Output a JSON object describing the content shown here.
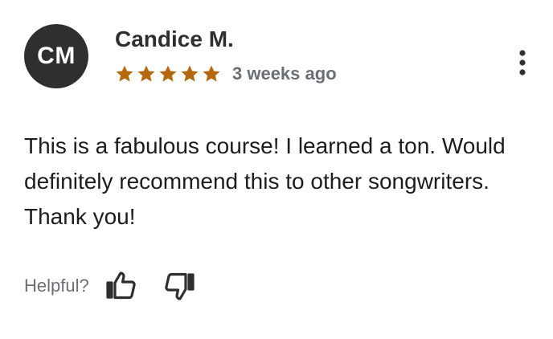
{
  "review": {
    "avatar_initials": "CM",
    "reviewer_name": "Candice M.",
    "rating": 5,
    "rating_max": 5,
    "star_color": "#b4690e",
    "date": "3 weeks ago",
    "more_icon": "more-vertical-icon",
    "text": "This is a fabulous course! I learned a ton. Would definitely recommend this to other songwriters. Thank you!"
  },
  "feedback": {
    "label": "Helpful?",
    "thumbs_up_icon": "thumbs-up-icon",
    "thumbs_down_icon": "thumbs-down-icon"
  }
}
